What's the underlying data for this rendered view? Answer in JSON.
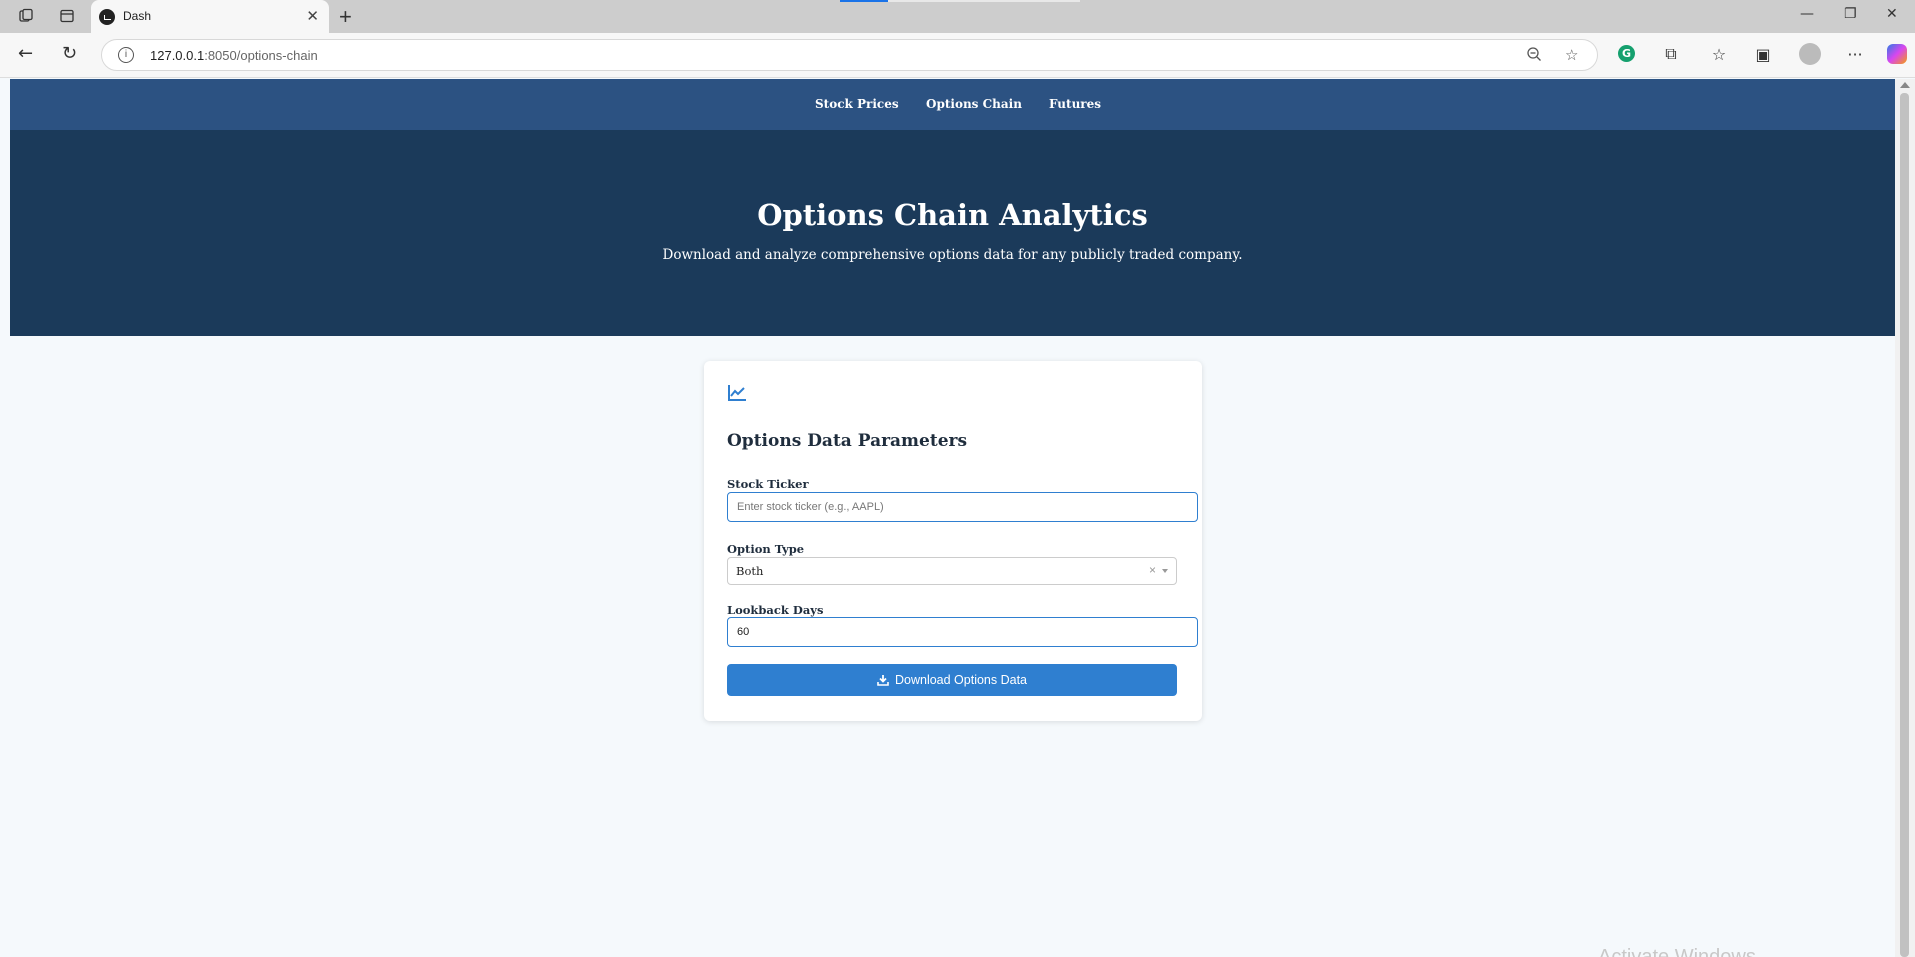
{
  "browser": {
    "tab_title": "Dash",
    "url_host": "127.0.0.1",
    "url_path": ":8050/options-chain"
  },
  "nav": {
    "links": [
      "Stock Prices",
      "Options Chain",
      "Futures"
    ]
  },
  "hero": {
    "title": "Options Chain Analytics",
    "subtitle": "Download and analyze comprehensive options data for any publicly traded company."
  },
  "form": {
    "title": "Options Data Parameters",
    "ticker_label": "Stock Ticker",
    "ticker_placeholder": "Enter stock ticker (e.g., AAPL)",
    "ticker_value": "",
    "option_type_label": "Option Type",
    "option_type_value": "Both",
    "lookback_label": "Lookback Days",
    "lookback_value": "60",
    "download_button": "Download Options Data"
  },
  "os": {
    "watermark": "Activate Windows"
  },
  "colors": {
    "nav_bg": "#2c5282",
    "hero_bg": "#1b3a5a",
    "accent": "#2f7fd0"
  }
}
